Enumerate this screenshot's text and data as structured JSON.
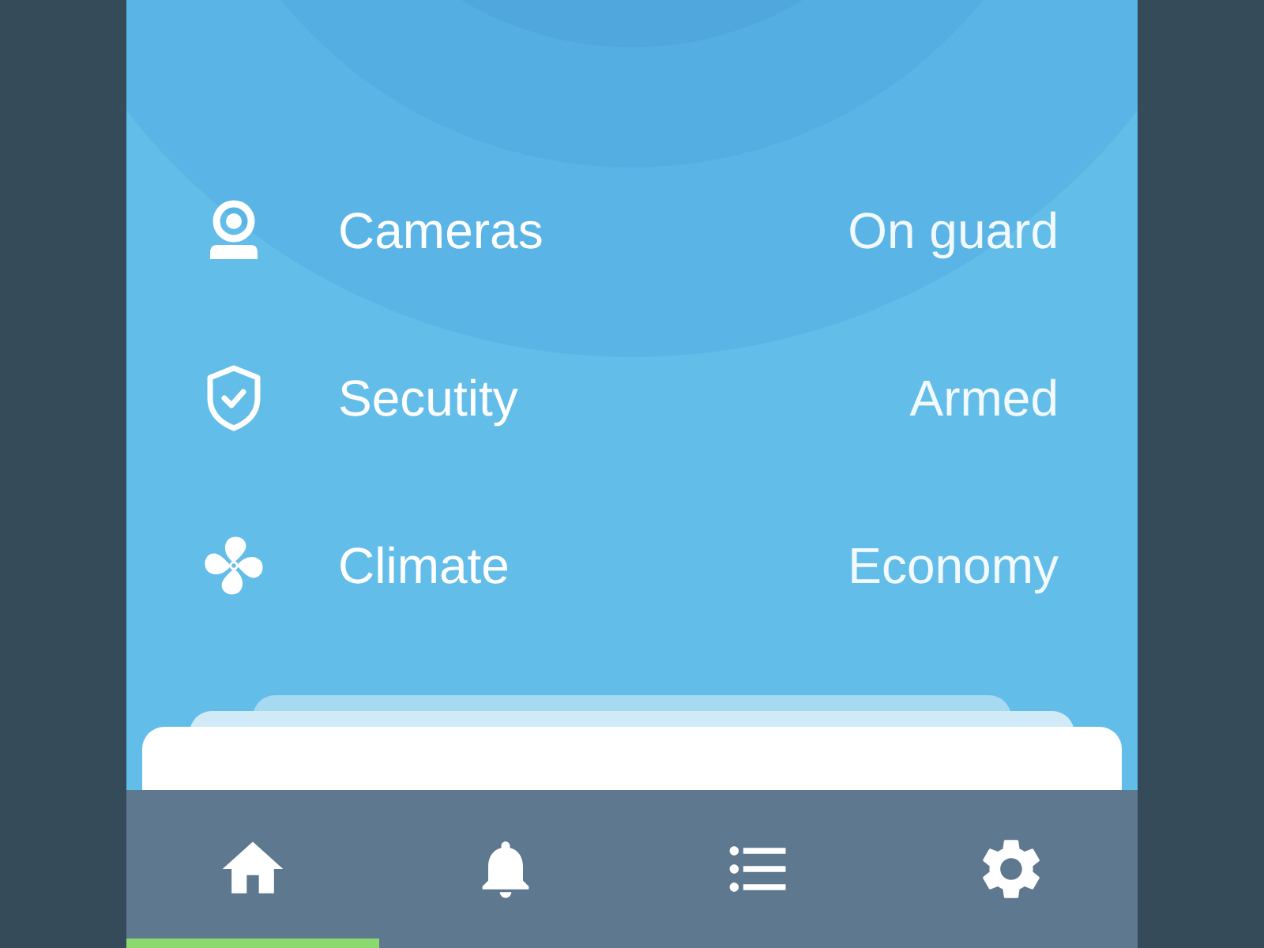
{
  "devices": [
    {
      "kind": "camera",
      "label": "Cameras",
      "status": "On guard"
    },
    {
      "kind": "shield",
      "label": "Secutity",
      "status": "Armed"
    },
    {
      "kind": "fan",
      "label": "Climate",
      "status": "Economy"
    }
  ],
  "nav": [
    {
      "kind": "home",
      "selected": true
    },
    {
      "kind": "bell",
      "selected": false
    },
    {
      "kind": "list",
      "selected": false
    },
    {
      "kind": "gear",
      "selected": false
    }
  ]
}
